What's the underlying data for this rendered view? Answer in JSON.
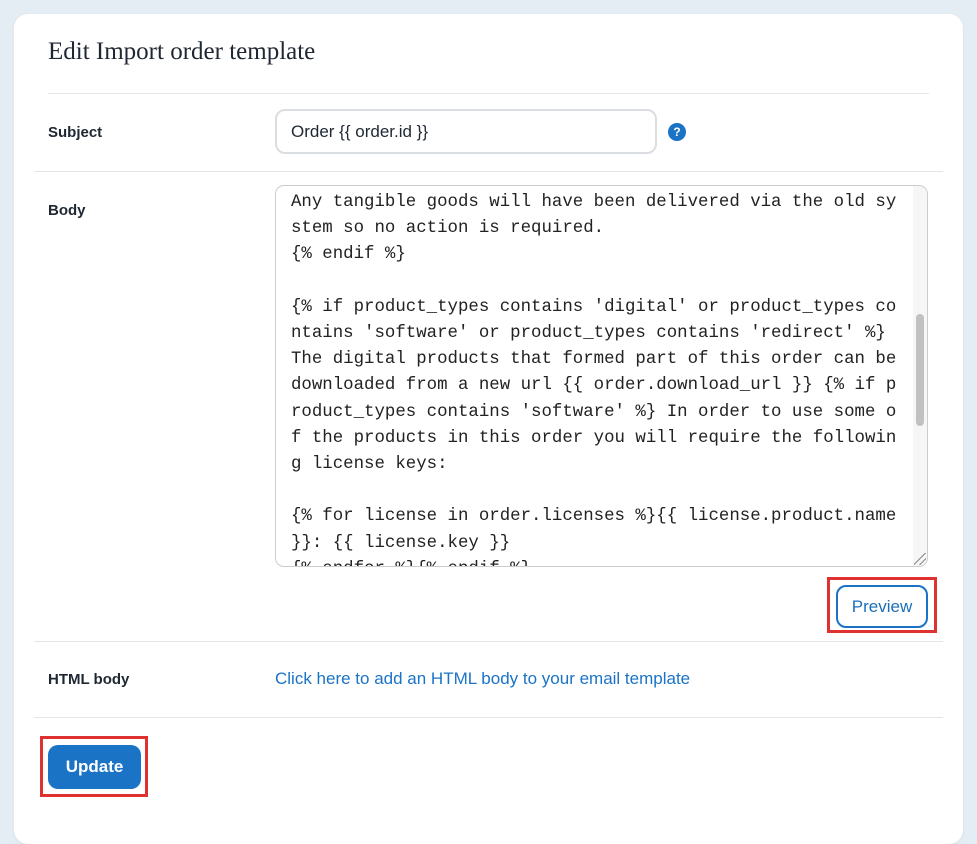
{
  "page": {
    "title": "Edit Import order template"
  },
  "form": {
    "subject": {
      "label": "Subject",
      "value": "Order {{ order.id }}",
      "help_icon": "?"
    },
    "body": {
      "label": "Body",
      "visible_text": "Any tangible goods will have been delivered via the old sy\nstem so no action is required.\n{% endif %}\n\n{% if product_types contains 'digital' or product_types co\nntains 'software' or product_types contains 'redirect' %}\nThe digital products that formed part of this order can be\ndownloaded from a new url {{ order.download_url }} {% if p\nroduct_types contains 'software' %} In order to use some o\nf the products in this order you will require the followin\ng license keys:\n\n{% for license in order.licenses %}{{ license.product.name\n}}: {{ license.key }}\n{% endfor %}{% endif %}"
    },
    "preview_label": "Preview",
    "html_body": {
      "label": "HTML body",
      "link_text": "Click here to add an HTML body to your email template"
    },
    "update_label": "Update"
  },
  "colors": {
    "accent": "#1b73c6",
    "highlight": "#e03131",
    "background": "#e4ecf4"
  }
}
